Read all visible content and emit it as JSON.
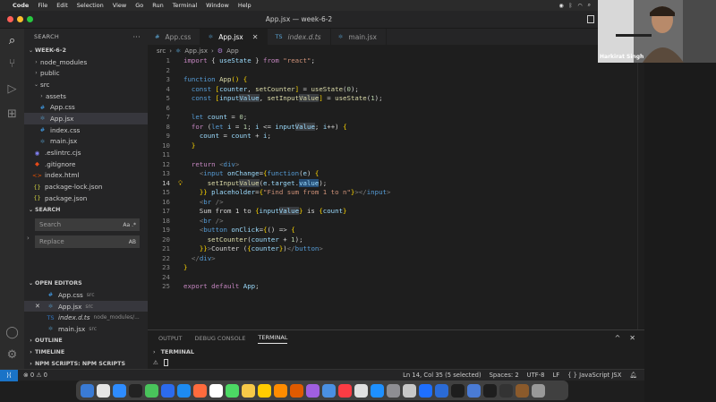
{
  "menubar": {
    "app_name": "Code",
    "items": [
      "File",
      "Edit",
      "Selection",
      "View",
      "Go",
      "Run",
      "Terminal",
      "Window",
      "Help"
    ]
  },
  "window": {
    "title": "App.jsx — week-6-2"
  },
  "sidebar": {
    "header": "SEARCH",
    "project": "WEEK-6-2",
    "tree": [
      {
        "label": "node_modules",
        "icon": "chevron-right-icon",
        "depth": 1
      },
      {
        "label": "public",
        "icon": "chevron-right-icon",
        "depth": 1
      },
      {
        "label": "src",
        "icon": "chevron-down-icon",
        "depth": 1
      },
      {
        "label": "assets",
        "icon": "chevron-right-icon",
        "depth": 2
      },
      {
        "label": "App.css",
        "icon": "css-file-icon",
        "depth": 2
      },
      {
        "label": "App.jsx",
        "icon": "react-file-icon",
        "depth": 2,
        "selected": true
      },
      {
        "label": "index.css",
        "icon": "css-file-icon",
        "depth": 2
      },
      {
        "label": "main.jsx",
        "icon": "react-file-icon",
        "depth": 2
      },
      {
        "label": ".eslintrc.cjs",
        "icon": "eslint-file-icon",
        "depth": 1
      },
      {
        "label": ".gitignore",
        "icon": "git-file-icon",
        "depth": 1
      },
      {
        "label": "index.html",
        "icon": "html-file-icon",
        "depth": 1
      },
      {
        "label": "package-lock.json",
        "icon": "json-file-icon",
        "depth": 1
      },
      {
        "label": "package.json",
        "icon": "json-file-icon",
        "depth": 1
      }
    ],
    "search_section": "SEARCH",
    "search_placeholder": "Search",
    "search_opts": "Aa  .*",
    "replace_placeholder": "Replace",
    "replace_opts": "AB",
    "open_editors_title": "OPEN EDITORS",
    "open_editors": [
      {
        "name": "App.css",
        "desc": "src",
        "icon": "css-file-icon"
      },
      {
        "name": "App.jsx",
        "desc": "src",
        "icon": "react-file-icon",
        "active": true
      },
      {
        "name": "index.d.ts",
        "desc": "node_modules/...",
        "icon": "ts-file-icon"
      },
      {
        "name": "main.jsx",
        "desc": "src",
        "icon": "react-file-icon"
      }
    ],
    "outline": "OUTLINE",
    "timeline": "TIMELINE",
    "npm_scripts": "NPM SCRIPTS: NPM SCRIPTS"
  },
  "tabs": [
    {
      "label": "App.css",
      "icon": "#",
      "active": false
    },
    {
      "label": "App.jsx",
      "icon": "⚛",
      "active": true
    },
    {
      "label": "index.d.ts",
      "icon": "TS",
      "active": false,
      "italic": true
    },
    {
      "label": "main.jsx",
      "icon": "⚛",
      "active": false
    }
  ],
  "breadcrumb": [
    "src",
    "App.jsx",
    "App"
  ],
  "code": [
    {
      "n": "1",
      "html": "<span class='kw'>import</span> { <span class='var'>useState</span> } <span class='kw'>from</span> <span class='str'>\"react\"</span>;"
    },
    {
      "n": "2",
      "html": ""
    },
    {
      "n": "3",
      "html": "<span class='kw2'>function</span> <span class='fn'>App</span><span class='br'>()</span> <span class='br'>{</span>"
    },
    {
      "n": "4",
      "html": "  <span class='kw2'>const</span> <span class='br'>[</span><span class='var'>counter</span>, <span class='fn'>setCounter</span><span class='br'>]</span> = <span class='fn'>useState</span>(<span class='num'>0</span>);"
    },
    {
      "n": "5",
      "html": "  <span class='kw2'>const</span> <span class='br'>[</span><span class='var'>input<span class='hl2'>Value</span></span>, <span class='fn'>setInput<span class='hl2'>Value</span></span><span class='br'>]</span> = <span class='fn'>useState</span>(<span class='num'>1</span>);"
    },
    {
      "n": "6",
      "html": ""
    },
    {
      "n": "7",
      "html": "  <span class='kw2'>let</span> <span class='var'>count</span> = <span class='num'>0</span>;"
    },
    {
      "n": "8",
      "html": "  <span class='kw'>for</span> (<span class='kw2'>let</span> <span class='var'>i</span> = <span class='num'>1</span>; <span class='var'>i</span> &lt;= <span class='var'>input<span class='hl2'>Value</span></span>; <span class='var'>i</span>++) <span class='br'>{</span>"
    },
    {
      "n": "9",
      "html": "    <span class='var'>count</span> = <span class='var'>count</span> + <span class='var'>i</span>;"
    },
    {
      "n": "10",
      "html": "  <span class='br'>}</span>"
    },
    {
      "n": "11",
      "html": ""
    },
    {
      "n": "12",
      "html": "  <span class='kw'>return</span> <span class='gray'>&lt;</span><span class='tag'>div</span><span class='gray'>&gt;</span>"
    },
    {
      "n": "13",
      "html": "    <span class='gray'>&lt;</span><span class='tag'>input</span> <span class='attr'>onChange</span>=<span class='br'>{</span><span class='kw2'>function</span>(<span class='var'>e</span>) <span class='br'>{</span>"
    },
    {
      "n": "14",
      "html": "      <span class='fn'>setInput<span class='hl2'>Value</span></span>(<span class='var'>e</span>.<span class='var'>target</span>.<span class='var hl'>value</span>);",
      "current": true,
      "bulb": true
    },
    {
      "n": "15",
      "html": "    <span class='br'>}}</span> <span class='attr'>placeholder</span>=<span class='br'>{</span><span class='str'>\"Find sum from 1 to n\"</span><span class='br'>}</span><span class='gray'>&gt;&lt;/</span><span class='tag'>input</span><span class='gray'>&gt;</span>"
    },
    {
      "n": "16",
      "html": "    <span class='gray'>&lt;</span><span class='tag'>br</span> <span class='gray'>/&gt;</span>"
    },
    {
      "n": "17",
      "html": "    Sum from 1 to <span class='br'>{</span><span class='var'>input<span class='hl2'>Value</span></span><span class='br'>}</span> is <span class='br'>{</span><span class='var'>count</span><span class='br'>}</span>"
    },
    {
      "n": "18",
      "html": "    <span class='gray'>&lt;</span><span class='tag'>br</span> <span class='gray'>/&gt;</span>"
    },
    {
      "n": "19",
      "html": "    <span class='gray'>&lt;</span><span class='tag'>button</span> <span class='attr'>onClick</span>=<span class='br'>{</span>() =&gt; <span class='br'>{</span>"
    },
    {
      "n": "20",
      "html": "      <span class='fn'>setCounter</span>(<span class='var'>counter</span> + <span class='num'>1</span>);"
    },
    {
      "n": "21",
      "html": "    <span class='br'>}}</span><span class='gray'>&gt;</span>Counter (<span class='br'>{</span><span class='var'>counter</span><span class='br'>}</span>)<span class='gray'>&lt;/</span><span class='tag'>button</span><span class='gray'>&gt;</span>"
    },
    {
      "n": "22",
      "html": "  <span class='gray'>&lt;/</span><span class='tag'>div</span><span class='gray'>&gt;</span>"
    },
    {
      "n": "23",
      "html": "<span class='br'>}</span>"
    },
    {
      "n": "24",
      "html": ""
    },
    {
      "n": "25",
      "html": "<span class='kw'>export</span> <span class='kw'>default</span> <span class='var'>App</span>;"
    }
  ],
  "panel": {
    "tabs": [
      "OUTPUT",
      "DEBUG CONSOLE",
      "TERMINAL"
    ],
    "active_tab": "TERMINAL",
    "terminal_name": "TERMINAL"
  },
  "statusbar": {
    "problems": "⊗ 0 ⚠ 0",
    "cursor": "Ln 14, Col 35 (5 selected)",
    "spaces": "Spaces: 2",
    "encoding": "UTF-8",
    "eol": "LF",
    "language": "{ } JavaScript JSX"
  },
  "webcam": {
    "name": "Harkirat Singh"
  },
  "colors": {
    "accent": "#007acc",
    "remote": "#1a73c7"
  }
}
